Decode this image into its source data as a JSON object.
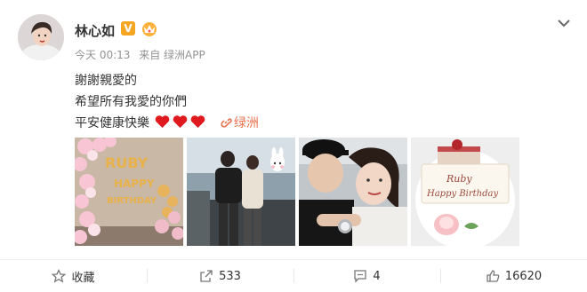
{
  "post": {
    "username": "林心如",
    "verified_label": "V",
    "meta": {
      "time": "今天 00:13",
      "source": "来自 绿洲APP"
    },
    "text_lines": [
      "謝謝親愛的",
      "希望所有我愛的你們",
      "平安健康快樂"
    ],
    "hearts": 3,
    "link_label": "绿洲",
    "photos": [
      {
        "name": "balloon-birthday-photo",
        "text": "RUBY HAPPY BIRTHDAY"
      },
      {
        "name": "couple-party-photo"
      },
      {
        "name": "couple-selfie-photo"
      },
      {
        "name": "cake-photo",
        "text": "Ruby Happy Birthday"
      }
    ]
  },
  "actions": [
    {
      "label": "收藏",
      "icon": "star-icon"
    },
    {
      "label": "533",
      "icon": "share-icon"
    },
    {
      "label": "4",
      "icon": "comment-icon"
    },
    {
      "label": "16620",
      "icon": "like-icon"
    }
  ],
  "colors": {
    "link": "#eb7350",
    "meta": "#939393",
    "heart": "#e0191f",
    "verified": "#f5a623"
  }
}
